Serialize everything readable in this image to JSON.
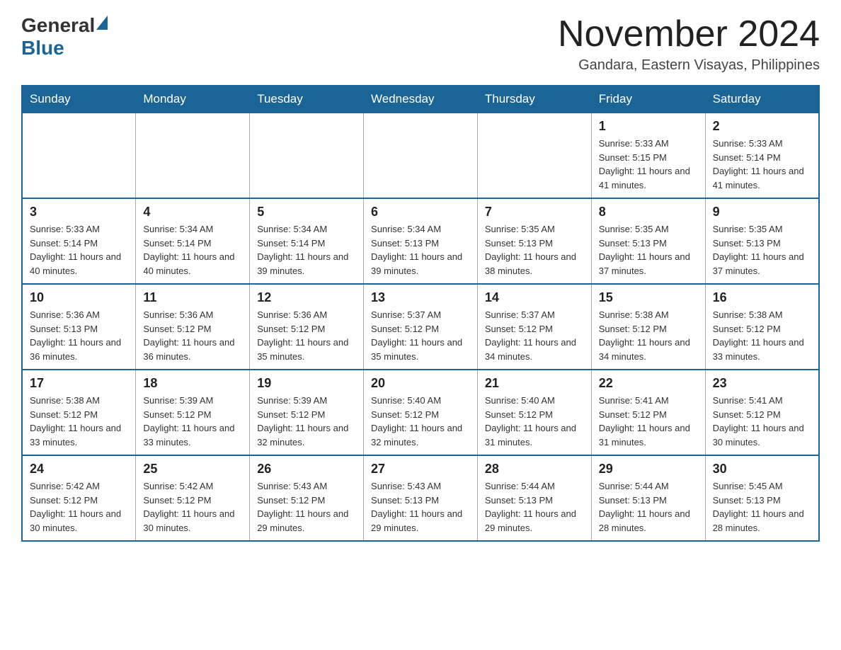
{
  "header": {
    "logo_general": "General",
    "logo_blue": "Blue",
    "month_title": "November 2024",
    "location": "Gandara, Eastern Visayas, Philippines"
  },
  "days_of_week": [
    "Sunday",
    "Monday",
    "Tuesday",
    "Wednesday",
    "Thursday",
    "Friday",
    "Saturday"
  ],
  "weeks": [
    [
      {
        "day": "",
        "sunrise": "",
        "sunset": "",
        "daylight": "",
        "empty": true
      },
      {
        "day": "",
        "sunrise": "",
        "sunset": "",
        "daylight": "",
        "empty": true
      },
      {
        "day": "",
        "sunrise": "",
        "sunset": "",
        "daylight": "",
        "empty": true
      },
      {
        "day": "",
        "sunrise": "",
        "sunset": "",
        "daylight": "",
        "empty": true
      },
      {
        "day": "",
        "sunrise": "",
        "sunset": "",
        "daylight": "",
        "empty": true
      },
      {
        "day": "1",
        "sunrise": "Sunrise: 5:33 AM",
        "sunset": "Sunset: 5:15 PM",
        "daylight": "Daylight: 11 hours and 41 minutes.",
        "empty": false
      },
      {
        "day": "2",
        "sunrise": "Sunrise: 5:33 AM",
        "sunset": "Sunset: 5:14 PM",
        "daylight": "Daylight: 11 hours and 41 minutes.",
        "empty": false
      }
    ],
    [
      {
        "day": "3",
        "sunrise": "Sunrise: 5:33 AM",
        "sunset": "Sunset: 5:14 PM",
        "daylight": "Daylight: 11 hours and 40 minutes.",
        "empty": false
      },
      {
        "day": "4",
        "sunrise": "Sunrise: 5:34 AM",
        "sunset": "Sunset: 5:14 PM",
        "daylight": "Daylight: 11 hours and 40 minutes.",
        "empty": false
      },
      {
        "day": "5",
        "sunrise": "Sunrise: 5:34 AM",
        "sunset": "Sunset: 5:14 PM",
        "daylight": "Daylight: 11 hours and 39 minutes.",
        "empty": false
      },
      {
        "day": "6",
        "sunrise": "Sunrise: 5:34 AM",
        "sunset": "Sunset: 5:13 PM",
        "daylight": "Daylight: 11 hours and 39 minutes.",
        "empty": false
      },
      {
        "day": "7",
        "sunrise": "Sunrise: 5:35 AM",
        "sunset": "Sunset: 5:13 PM",
        "daylight": "Daylight: 11 hours and 38 minutes.",
        "empty": false
      },
      {
        "day": "8",
        "sunrise": "Sunrise: 5:35 AM",
        "sunset": "Sunset: 5:13 PM",
        "daylight": "Daylight: 11 hours and 37 minutes.",
        "empty": false
      },
      {
        "day": "9",
        "sunrise": "Sunrise: 5:35 AM",
        "sunset": "Sunset: 5:13 PM",
        "daylight": "Daylight: 11 hours and 37 minutes.",
        "empty": false
      }
    ],
    [
      {
        "day": "10",
        "sunrise": "Sunrise: 5:36 AM",
        "sunset": "Sunset: 5:13 PM",
        "daylight": "Daylight: 11 hours and 36 minutes.",
        "empty": false
      },
      {
        "day": "11",
        "sunrise": "Sunrise: 5:36 AM",
        "sunset": "Sunset: 5:12 PM",
        "daylight": "Daylight: 11 hours and 36 minutes.",
        "empty": false
      },
      {
        "day": "12",
        "sunrise": "Sunrise: 5:36 AM",
        "sunset": "Sunset: 5:12 PM",
        "daylight": "Daylight: 11 hours and 35 minutes.",
        "empty": false
      },
      {
        "day": "13",
        "sunrise": "Sunrise: 5:37 AM",
        "sunset": "Sunset: 5:12 PM",
        "daylight": "Daylight: 11 hours and 35 minutes.",
        "empty": false
      },
      {
        "day": "14",
        "sunrise": "Sunrise: 5:37 AM",
        "sunset": "Sunset: 5:12 PM",
        "daylight": "Daylight: 11 hours and 34 minutes.",
        "empty": false
      },
      {
        "day": "15",
        "sunrise": "Sunrise: 5:38 AM",
        "sunset": "Sunset: 5:12 PM",
        "daylight": "Daylight: 11 hours and 34 minutes.",
        "empty": false
      },
      {
        "day": "16",
        "sunrise": "Sunrise: 5:38 AM",
        "sunset": "Sunset: 5:12 PM",
        "daylight": "Daylight: 11 hours and 33 minutes.",
        "empty": false
      }
    ],
    [
      {
        "day": "17",
        "sunrise": "Sunrise: 5:38 AM",
        "sunset": "Sunset: 5:12 PM",
        "daylight": "Daylight: 11 hours and 33 minutes.",
        "empty": false
      },
      {
        "day": "18",
        "sunrise": "Sunrise: 5:39 AM",
        "sunset": "Sunset: 5:12 PM",
        "daylight": "Daylight: 11 hours and 33 minutes.",
        "empty": false
      },
      {
        "day": "19",
        "sunrise": "Sunrise: 5:39 AM",
        "sunset": "Sunset: 5:12 PM",
        "daylight": "Daylight: 11 hours and 32 minutes.",
        "empty": false
      },
      {
        "day": "20",
        "sunrise": "Sunrise: 5:40 AM",
        "sunset": "Sunset: 5:12 PM",
        "daylight": "Daylight: 11 hours and 32 minutes.",
        "empty": false
      },
      {
        "day": "21",
        "sunrise": "Sunrise: 5:40 AM",
        "sunset": "Sunset: 5:12 PM",
        "daylight": "Daylight: 11 hours and 31 minutes.",
        "empty": false
      },
      {
        "day": "22",
        "sunrise": "Sunrise: 5:41 AM",
        "sunset": "Sunset: 5:12 PM",
        "daylight": "Daylight: 11 hours and 31 minutes.",
        "empty": false
      },
      {
        "day": "23",
        "sunrise": "Sunrise: 5:41 AM",
        "sunset": "Sunset: 5:12 PM",
        "daylight": "Daylight: 11 hours and 30 minutes.",
        "empty": false
      }
    ],
    [
      {
        "day": "24",
        "sunrise": "Sunrise: 5:42 AM",
        "sunset": "Sunset: 5:12 PM",
        "daylight": "Daylight: 11 hours and 30 minutes.",
        "empty": false
      },
      {
        "day": "25",
        "sunrise": "Sunrise: 5:42 AM",
        "sunset": "Sunset: 5:12 PM",
        "daylight": "Daylight: 11 hours and 30 minutes.",
        "empty": false
      },
      {
        "day": "26",
        "sunrise": "Sunrise: 5:43 AM",
        "sunset": "Sunset: 5:12 PM",
        "daylight": "Daylight: 11 hours and 29 minutes.",
        "empty": false
      },
      {
        "day": "27",
        "sunrise": "Sunrise: 5:43 AM",
        "sunset": "Sunset: 5:13 PM",
        "daylight": "Daylight: 11 hours and 29 minutes.",
        "empty": false
      },
      {
        "day": "28",
        "sunrise": "Sunrise: 5:44 AM",
        "sunset": "Sunset: 5:13 PM",
        "daylight": "Daylight: 11 hours and 29 minutes.",
        "empty": false
      },
      {
        "day": "29",
        "sunrise": "Sunrise: 5:44 AM",
        "sunset": "Sunset: 5:13 PM",
        "daylight": "Daylight: 11 hours and 28 minutes.",
        "empty": false
      },
      {
        "day": "30",
        "sunrise": "Sunrise: 5:45 AM",
        "sunset": "Sunset: 5:13 PM",
        "daylight": "Daylight: 11 hours and 28 minutes.",
        "empty": false
      }
    ]
  ]
}
